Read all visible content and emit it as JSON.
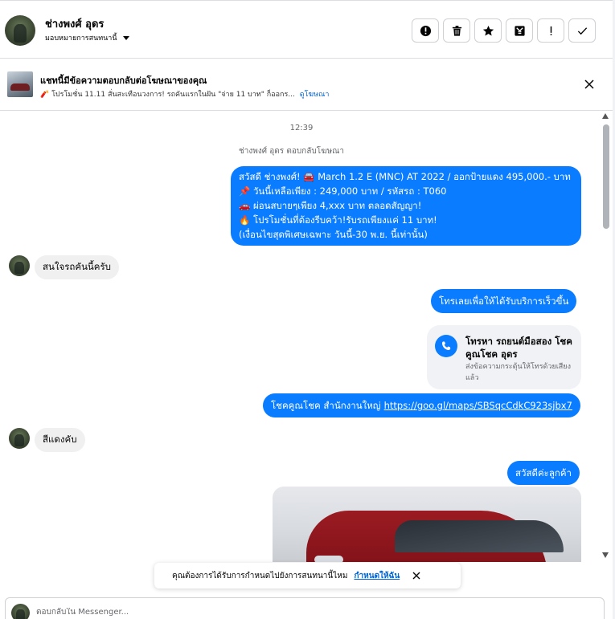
{
  "header": {
    "contact_name": "ช่างพงศ์ อุดร",
    "assign_label": "มอบหมายการสนทนานี้",
    "toolbar": [
      {
        "name": "spam-button",
        "icon": "alert-circle-icon"
      },
      {
        "name": "delete-button",
        "icon": "trash-icon"
      },
      {
        "name": "star-button",
        "icon": "star-icon"
      },
      {
        "name": "archive-button",
        "icon": "archive-icon"
      },
      {
        "name": "follow-up-button",
        "icon": "exclamation-icon"
      },
      {
        "name": "mark-done-button",
        "icon": "check-icon"
      }
    ]
  },
  "ad_banner": {
    "title": "แชทนี้มีข้อความตอบกลับต่อโฆษณาของคุณ",
    "subtitle": "🧨 โปรโมชั่น 11.11 สั่นสะเทือนวงการ! รถคันแรกในฝัน \"จ่าย 11 บาท\" ก็ออกร...",
    "link": "ดูโฆษณา"
  },
  "chat": {
    "time": "12:39",
    "reply_note": "ช่างพงศ์ อุดร ตอบกลับโฆษณา",
    "ad_message_lines": [
      "สวัสดี ช่างพงศ์! 🚘 March 1.2 E (MNC) AT 2022 / ออกป้ายแดง 495,000.- บาท",
      "📌 วันนี้เหลือเพียง : 249,000 บาท  / รหัสรถ : T060",
      "🚗 ผ่อนสบายๆเพียง 4,xxx บาท ตลอดสัญญา!",
      "🔥 โปรโมชั่นที่ต้องรีบคว้า!รับรถเพียงแค่ 11 บาท!",
      "(เงื่อนไขสุดพิเศษเฉพาะ วันนี้-30 พ.ย. นี้เท่านั้น)"
    ],
    "customer_msg_1": "สนใจรถคันนี้ครับ",
    "agent_msg_1": "โทรเลยเพื่อให้ได้รับบริการเร็วขึ้น",
    "call_card": {
      "title": "โทรหา รถยนต์มือสอง โชคคูณโชค อุดร",
      "subtitle": "ส่งข้อความกระตุ้นให้โทรด้วยเสียงแล้ว"
    },
    "agent_msg_2_text": "โชคคูณโชค สำนักงานใหญ่",
    "agent_msg_2_link": "https://goo.gl/maps/SBSqcCdkC923sjbx7",
    "customer_msg_2": "สีแดงคับ",
    "agent_msg_3": "สวัสดีค่ะลูกค้า"
  },
  "prompt": {
    "text": "คุณต้องการได้รับการกำหนดไปยังการสนทนานี้ไหม",
    "action": "กำหนดให้ฉัน"
  },
  "composer": {
    "placeholder": "ตอบกลับใน Messenger..."
  },
  "colors": {
    "accent": "#0a7cff",
    "incoming_bubble": "#f0f0f0",
    "link": "#0064d1"
  }
}
